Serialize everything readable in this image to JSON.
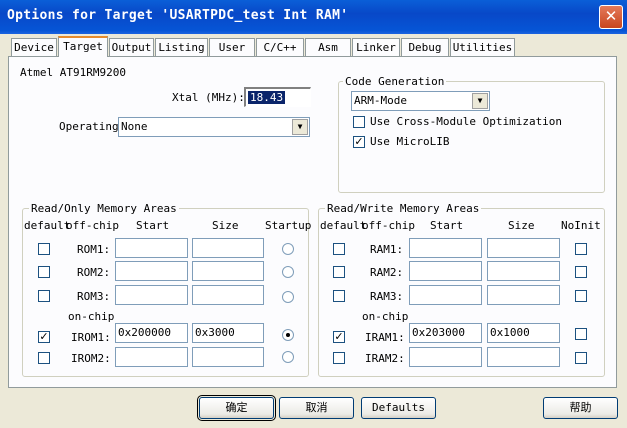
{
  "window": {
    "title": "Options for Target 'USARTPDC_test Int RAM'"
  },
  "tabs": [
    "Device",
    "Target",
    "Output",
    "Listing",
    "User",
    "C/C++",
    "Asm",
    "Linker",
    "Debug",
    "Utilities"
  ],
  "active_tab": "Target",
  "device_name": "Atmel AT91RM9200",
  "xtal": {
    "label": "Xtal (MHz):",
    "value": "18.43"
  },
  "operating": {
    "label": "Operating",
    "value": "None"
  },
  "code_gen": {
    "title": "Code Generation",
    "mode": "ARM-Mode",
    "cross_module": {
      "label": "Use Cross-Module Optimization",
      "checked": false
    },
    "microlib": {
      "label": "Use MicroLIB",
      "checked": true
    }
  },
  "ro_memory": {
    "title": "Read/Only Memory Areas",
    "headers": {
      "default": "default",
      "offchip": "off-chip",
      "start": "Start",
      "size": "Size",
      "startup": "Startup"
    },
    "onchip_label": "on-chip",
    "rows": [
      {
        "name": "ROM1:",
        "default": false,
        "start": "",
        "size": "",
        "startup": false
      },
      {
        "name": "ROM2:",
        "default": false,
        "start": "",
        "size": "",
        "startup": false
      },
      {
        "name": "ROM3:",
        "default": false,
        "start": "",
        "size": "",
        "startup": false
      },
      {
        "name": "IROM1:",
        "default": true,
        "start": "0x200000",
        "size": "0x3000",
        "startup": true
      },
      {
        "name": "IROM2:",
        "default": false,
        "start": "",
        "size": "",
        "startup": false
      }
    ]
  },
  "rw_memory": {
    "title": "Read/Write Memory Areas",
    "headers": {
      "default": "default",
      "offchip": "off-chip",
      "start": "Start",
      "size": "Size",
      "noinit": "NoInit"
    },
    "onchip_label": "on-chip",
    "rows": [
      {
        "name": "RAM1:",
        "default": false,
        "start": "",
        "size": "",
        "noinit": false
      },
      {
        "name": "RAM2:",
        "default": false,
        "start": "",
        "size": "",
        "noinit": false
      },
      {
        "name": "RAM3:",
        "default": false,
        "start": "",
        "size": "",
        "noinit": false
      },
      {
        "name": "IRAM1:",
        "default": true,
        "start": "0x203000",
        "size": "0x1000",
        "noinit": false
      },
      {
        "name": "IRAM2:",
        "default": false,
        "start": "",
        "size": "",
        "noinit": false
      }
    ]
  },
  "buttons": {
    "ok": "确定",
    "cancel": "取消",
    "defaults": "Defaults",
    "help": "帮助"
  }
}
